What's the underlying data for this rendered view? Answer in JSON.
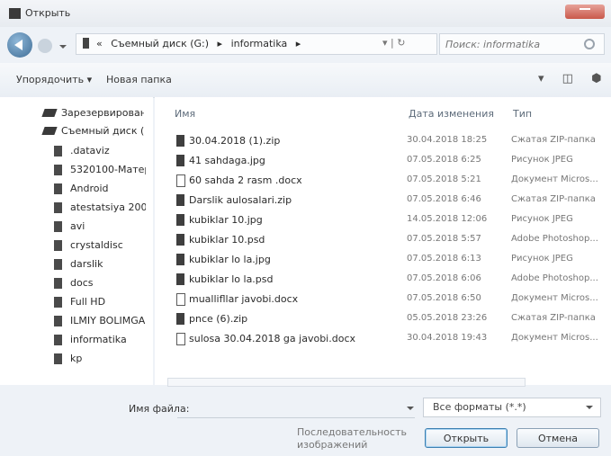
{
  "window": {
    "title": "Открыть"
  },
  "address": {
    "crumbs": [
      "«",
      "Съемный диск (G:)",
      "▸",
      "informatika",
      "▸"
    ],
    "tools": "▾ | ↻",
    "search_placeholder": "Поиск: informatika"
  },
  "toolbar": {
    "organize_label": "Упорядочить ▾",
    "new_folder_label": "Новая папка",
    "tools": [
      "▾",
      "◫",
      "⬢"
    ]
  },
  "sidebar": {
    "items": [
      {
        "label": "Зарезервирован",
        "kind": "drive"
      },
      {
        "label": "Съемный диск (",
        "kind": "drive"
      },
      {
        "label": ".dataviz",
        "kind": "folder"
      },
      {
        "label": "5320100-Матер",
        "kind": "folder"
      },
      {
        "label": "Android",
        "kind": "folder"
      },
      {
        "label": "atestatsiya 200",
        "kind": "folder"
      },
      {
        "label": "avi",
        "kind": "folder"
      },
      {
        "label": "crystaldisc",
        "kind": "folder"
      },
      {
        "label": "darslik",
        "kind": "folder"
      },
      {
        "label": "docs",
        "kind": "folder"
      },
      {
        "label": "Full HD",
        "kind": "folder"
      },
      {
        "label": "ILMIY BOLIMGA",
        "kind": "folder"
      },
      {
        "label": "informatika",
        "kind": "folder"
      },
      {
        "label": "kp",
        "kind": "folder"
      }
    ]
  },
  "files": {
    "headers": {
      "name": "Имя",
      "date": "Дата изменения",
      "type": "Тип"
    },
    "rows": [
      {
        "name": "30.04.2018 (1).zip",
        "date": "30.04.2018 18:25",
        "type": "Сжатая ZIP-папка",
        "icon": "zip"
      },
      {
        "name": "41 sahdaga.jpg",
        "date": "07.05.2018 6:25",
        "type": "Рисунок JPEG",
        "icon": "image"
      },
      {
        "name": "60 sahda 2 rasm .docx",
        "date": "07.05.2018 5:21",
        "type": "Документ Micros...",
        "icon": "doc"
      },
      {
        "name": "Darslik aulosalari.zip",
        "date": "07.05.2018 6:46",
        "type": "Сжатая ZIP-папка",
        "icon": "zip"
      },
      {
        "name": "kubiklar 10.jpg",
        "date": "14.05.2018 12:06",
        "type": "Рисунок JPEG",
        "icon": "image"
      },
      {
        "name": "kubiklar 10.psd",
        "date": "07.05.2018 5:57",
        "type": "Adobe Photoshop...",
        "icon": "psd"
      },
      {
        "name": "kubiklar lo la.jpg",
        "date": "07.05.2018 6:13",
        "type": "Рисунок JPEG",
        "icon": "image"
      },
      {
        "name": "kubiklar lo la.psd",
        "date": "07.05.2018 6:06",
        "type": "Adobe Photoshop...",
        "icon": "psd"
      },
      {
        "name": "muallifllar javobi.docx",
        "date": "07.05.2018 6:50",
        "type": "Документ Micros...",
        "icon": "doc"
      },
      {
        "name": "pnce (6).zip",
        "date": "05.05.2018 23:26",
        "type": "Сжатая ZIP-папка",
        "icon": "zip"
      },
      {
        "name": "sulosa 30.04.2018 ga javobi.docx",
        "date": "30.04.2018 19:43",
        "type": "Документ Micros...",
        "icon": "doc"
      }
    ]
  },
  "bottom": {
    "filename_label": "Имя файла:",
    "filename_value": "",
    "filter_value": "Все форматы (*.*)",
    "sequence_label": "Последовательность изображений",
    "open_label": "Открыть",
    "cancel_label": "Отмена"
  }
}
